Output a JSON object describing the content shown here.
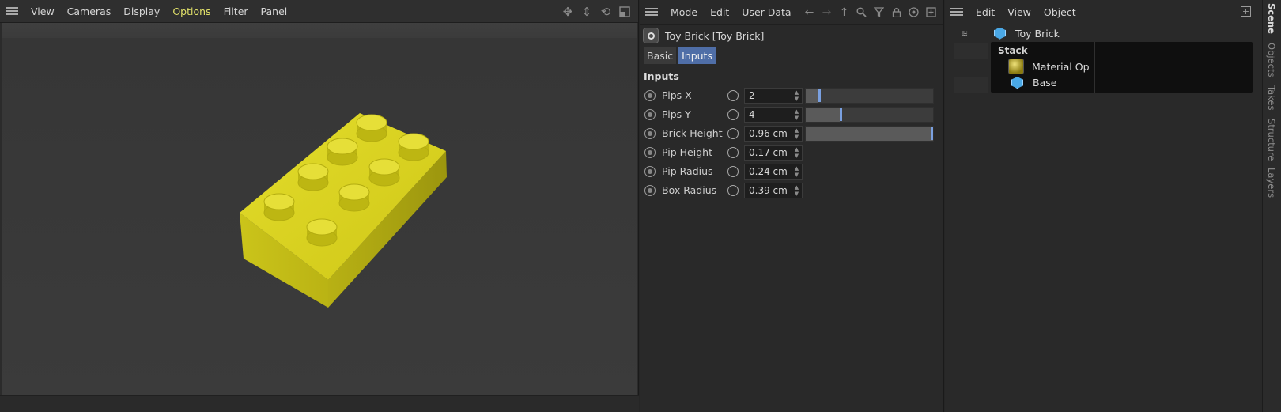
{
  "viewport": {
    "menu": [
      "View",
      "Cameras",
      "Display",
      "Options",
      "Filter",
      "Panel"
    ],
    "active_menu": "Options",
    "tools": [
      "move-view-icon",
      "zoom-view-icon",
      "rotate-view-icon",
      "toggle-layout-icon"
    ]
  },
  "attribute_manager": {
    "menu": [
      "Mode",
      "Edit",
      "User Data"
    ],
    "tools": [
      "back-arrow-icon",
      "forward-arrow-icon",
      "up-arrow-icon",
      "search-icon",
      "filter-icon",
      "lock-icon",
      "target-icon",
      "new-panel-icon"
    ],
    "object_title": "Toy Brick [Toy Brick]",
    "tabs": [
      {
        "label": "Basic",
        "selected": false
      },
      {
        "label": "Inputs",
        "selected": true
      }
    ],
    "group_title": "Inputs",
    "params": [
      {
        "name": "Pips X",
        "value": "2",
        "slider": 0.1
      },
      {
        "name": "Pips Y",
        "value": "4",
        "slider": 0.27
      },
      {
        "name": "Brick Height",
        "value": "0.96 cm",
        "slider": 1.0
      },
      {
        "name": "Pip Height",
        "value": "0.17 cm"
      },
      {
        "name": "Pip Radius",
        "value": "0.24 cm"
      },
      {
        "name": "Box Radius",
        "value": "0.39 cm"
      }
    ]
  },
  "object_manager": {
    "menu": [
      "Edit",
      "View",
      "Object"
    ],
    "root_object": "Toy Brick",
    "stack": {
      "title": "Stack",
      "items": [
        {
          "name": "Material Op",
          "icon": "material-icon"
        },
        {
          "name": "Base",
          "icon": "cube-icon"
        }
      ]
    }
  },
  "side_tabs": [
    "Scene",
    "Objects",
    "Takes",
    "Structure",
    "Layers"
  ],
  "active_side_tab": "Scene",
  "colors": {
    "accent": "#4f6ea7",
    "menu_active": "#e2e26a",
    "brick": "#d9d21a",
    "slider_handle": "#7aa0e0"
  }
}
